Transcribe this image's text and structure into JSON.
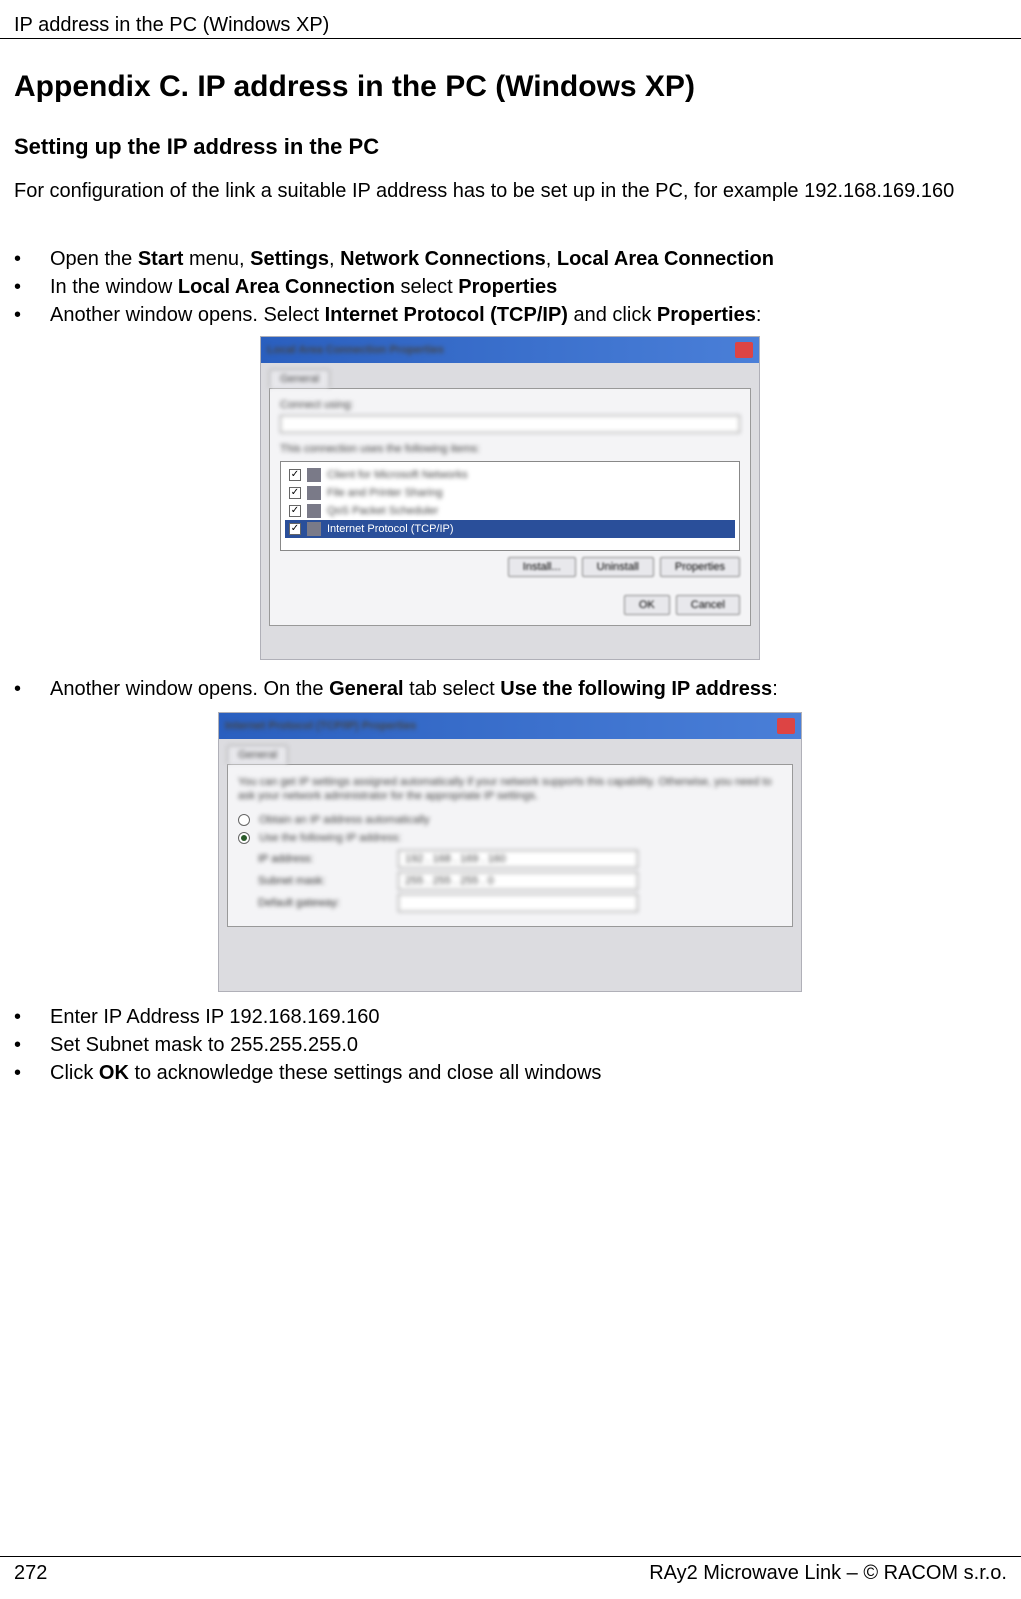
{
  "header": {
    "running_title": "IP address in the PC (Windows XP)"
  },
  "title": "Appendix C. IP address in the PC (Windows XP)",
  "subsection": "Setting up the IP address in the PC",
  "intro": "For configuration of the link a suitable IP address has to be set up in the PC, for example 192.168.169.160",
  "bullets1": {
    "b1_pre": "Open the ",
    "b1_s1": "Start",
    "b1_m1": " menu, ",
    "b1_s2": "Settings",
    "b1_m2": ", ",
    "b1_s3": "Network Connections",
    "b1_m3": ", ",
    "b1_s4": "Local Area Connection",
    "b2_pre": "In the window ",
    "b2_s1": "Local Area Connection",
    "b2_m1": " select ",
    "b2_s2": "Properties",
    "b3_pre": "Another window opens. Select ",
    "b3_s1": "Internet Protocol (TCP/IP)",
    "b3_m1": " and click ",
    "b3_s2": "Properties",
    "b3_post": ":"
  },
  "dialog1": {
    "connect_using_label": "Connect using:",
    "items_label": "This connection uses the following items:",
    "item_selected": "Internet Protocol (TCP/IP)",
    "btn_install": "Install...",
    "btn_uninstall": "Uninstall",
    "btn_properties": "Properties",
    "btn_ok": "OK",
    "btn_cancel": "Cancel"
  },
  "bullets2": {
    "b1_pre": "Another window opens. On the ",
    "b1_s1": "General",
    "b1_m1": " tab select ",
    "b1_s2": "Use the following IP address",
    "b1_post": ":"
  },
  "dialog2": {
    "tab_general": "General",
    "desc": "You can get IP settings assigned automatically if your network supports this capability. Otherwise, you need to ask your network administrator for the appropriate IP settings.",
    "radio_auto": "Obtain an IP address automatically",
    "radio_manual": "Use the following IP address:",
    "label_ip": "IP address:",
    "label_mask": "Subnet mask:",
    "label_gw": "Default gateway:",
    "value_ip": "192 . 168 . 169 . 160",
    "value_mask": "255 . 255 . 255 .   0",
    "value_gw": ""
  },
  "bullets3": {
    "b1": "Enter IP Address IP 192.168.169.160",
    "b2": "Set Subnet mask to 255.255.255.0",
    "b3_pre": "Click ",
    "b3_s1": "OK",
    "b3_post": " to acknowledge these settings and close all windows"
  },
  "footer": {
    "page": "272",
    "right": "RAy2 Microwave Link – © RACOM s.r.o."
  }
}
